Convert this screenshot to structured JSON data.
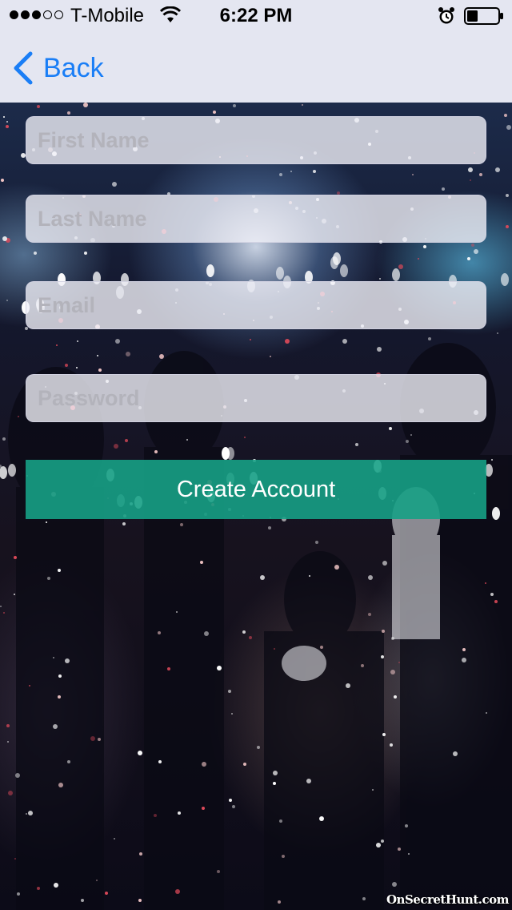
{
  "status_bar": {
    "carrier": "T-Mobile",
    "time": "6:22 PM",
    "signal_bars_filled": 3,
    "signal_bars_total": 5,
    "battery_level": 0.35,
    "icons": [
      "signal-dots-icon",
      "wifi-icon",
      "alarm-clock-icon",
      "battery-icon"
    ]
  },
  "nav": {
    "back_label": "Back",
    "back_icon": "chevron-left-icon",
    "accent_color": "#1a7ef6"
  },
  "form": {
    "first_name": {
      "placeholder": "First Name",
      "value": ""
    },
    "last_name": {
      "placeholder": "Last Name",
      "value": ""
    },
    "email": {
      "placeholder": "Email",
      "value": ""
    },
    "password": {
      "placeholder": "Password",
      "value": ""
    },
    "submit_label": "Create Account",
    "submit_color": "#16a085"
  },
  "background": {
    "watermark": "OnSecretHunt.com"
  }
}
